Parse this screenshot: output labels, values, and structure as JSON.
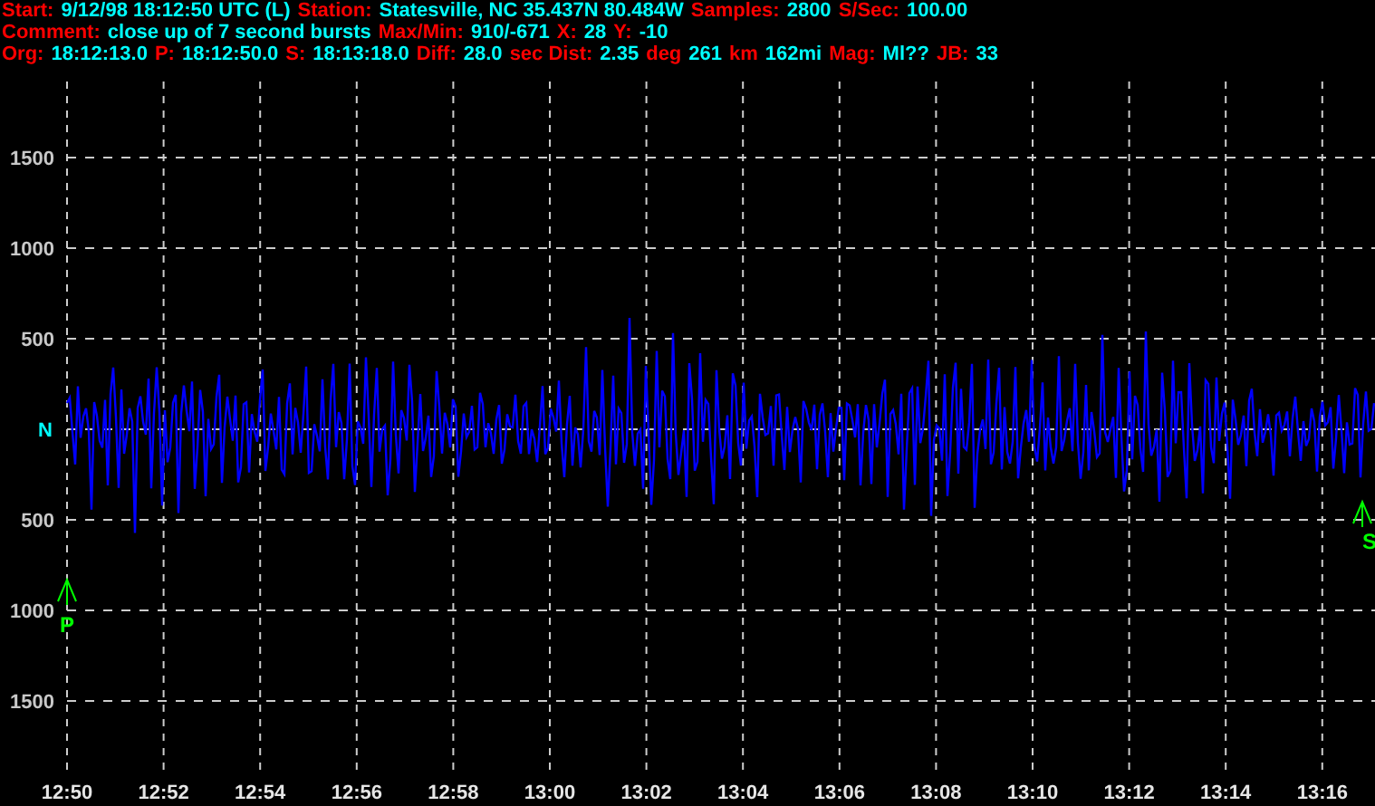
{
  "header": {
    "lines": [
      [
        {
          "kind": "label",
          "text": "Start:"
        },
        {
          "kind": "value",
          "text": "9/12/98 18:12:50 UTC (L)"
        },
        {
          "kind": "label",
          "text": "Station:"
        },
        {
          "kind": "value",
          "text": "Statesville, NC 35.437N 80.484W"
        },
        {
          "kind": "label",
          "text": "Samples:"
        },
        {
          "kind": "value",
          "text": "2800"
        },
        {
          "kind": "label",
          "text": "S/Sec:"
        },
        {
          "kind": "value",
          "text": "100.00"
        }
      ],
      [
        {
          "kind": "label",
          "text": "Comment:"
        },
        {
          "kind": "value",
          "text": "close up of 7 second bursts"
        },
        {
          "kind": "label",
          "text": "Max/Min:"
        },
        {
          "kind": "value",
          "text": "910/-671"
        },
        {
          "kind": "label",
          "text": "X:"
        },
        {
          "kind": "value",
          "text": "28"
        },
        {
          "kind": "label",
          "text": "Y:"
        },
        {
          "kind": "value",
          "text": "-10"
        }
      ],
      [
        {
          "kind": "label",
          "text": "Org:"
        },
        {
          "kind": "value",
          "text": "18:12:13.0"
        },
        {
          "kind": "label",
          "text": "P:"
        },
        {
          "kind": "value",
          "text": "18:12:50.0"
        },
        {
          "kind": "label",
          "text": "S:"
        },
        {
          "kind": "value",
          "text": "18:13:18.0"
        },
        {
          "kind": "label",
          "text": "Diff:"
        },
        {
          "kind": "value",
          "text": "28.0"
        },
        {
          "kind": "label",
          "text": "sec Dist:"
        },
        {
          "kind": "value",
          "text": "2.35"
        },
        {
          "kind": "label",
          "text": "deg"
        },
        {
          "kind": "value",
          "text": "261"
        },
        {
          "kind": "label",
          "text": "km"
        },
        {
          "kind": "value",
          "text": "162mi"
        },
        {
          "kind": "label",
          "text": "Mag:"
        },
        {
          "kind": "value",
          "text": "Ml??"
        },
        {
          "kind": "label",
          "text": "JB:"
        },
        {
          "kind": "value",
          "text": "33"
        }
      ]
    ]
  },
  "plot": {
    "y_labels": [
      {
        "kind": "number",
        "text": "1500"
      },
      {
        "kind": "number",
        "text": "1000"
      },
      {
        "kind": "number",
        "text": "500"
      },
      {
        "kind": "center",
        "text": "N"
      },
      {
        "kind": "number",
        "text": "500"
      },
      {
        "kind": "number",
        "text": "1000"
      },
      {
        "kind": "number",
        "text": "1500"
      }
    ],
    "time_labels": [
      "12:50",
      "12:52",
      "12:54",
      "12:56",
      "12:58",
      "13:00",
      "13:02",
      "13:04",
      "13:06",
      "13:08",
      "13:10",
      "13:12",
      "13:14",
      "13:16"
    ],
    "markers": [
      {
        "kind": "p",
        "letter": "P"
      },
      {
        "kind": "s",
        "letter": "S"
      }
    ]
  }
}
